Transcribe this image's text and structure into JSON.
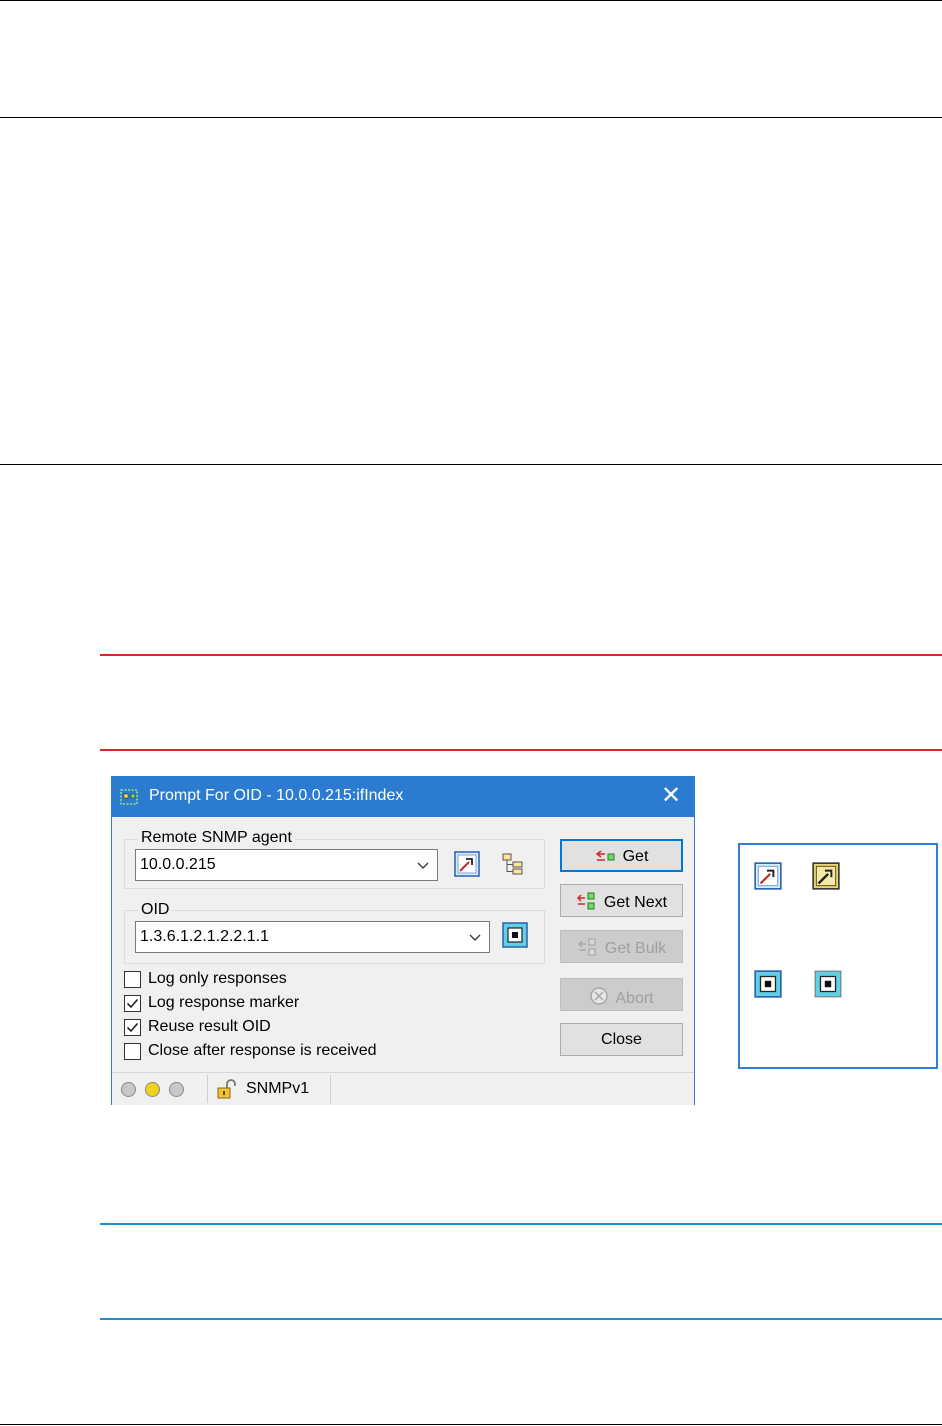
{
  "dialog": {
    "title": "Prompt For OID - 10.0.0.215:ifIndex",
    "agent_group": {
      "label": "Remote SNMP agent",
      "value": "10.0.0.215"
    },
    "oid_group": {
      "label": "OID",
      "value": "1.3.6.1.2.1.2.2.1.1"
    },
    "options": [
      {
        "label": "Log only responses",
        "checked": false
      },
      {
        "label": "Log response marker",
        "checked": true
      },
      {
        "label": "Reuse result OID",
        "checked": true
      },
      {
        "label": "Close after response is received",
        "checked": false
      }
    ],
    "buttons": {
      "get": "Get",
      "get_next": "Get Next",
      "get_bulk": "Get Bulk",
      "abort": "Abort",
      "close": "Close"
    },
    "status": {
      "leds": [
        "#c8c8c8",
        "#f2d21b",
        "#c8c8c8"
      ],
      "protocol": "SNMPv1"
    }
  },
  "colors": {
    "title_bar": "#2b7bd0",
    "warning_line": "#d9262a",
    "info_line": "#1f8fcf",
    "legend_border": "#2f7ed8"
  },
  "legend_icons": [
    "agent-properties-icon",
    "agent-properties-highlighted-icon",
    "oid-select-icon",
    "oid-select-highlighted-icon"
  ]
}
